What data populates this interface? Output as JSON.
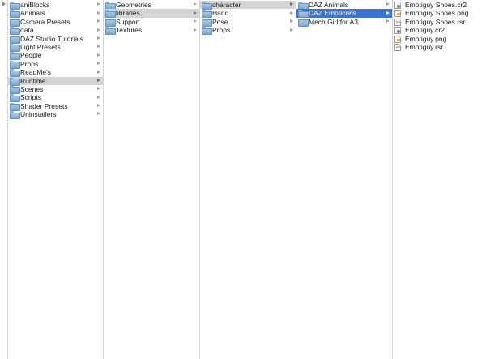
{
  "columns": [
    {
      "items": [
        {
          "label": "aniBlocks",
          "type": "folder"
        },
        {
          "label": "Animals",
          "type": "folder"
        },
        {
          "label": "Camera Presets",
          "type": "folder"
        },
        {
          "label": "data",
          "type": "folder"
        },
        {
          "label": "DAZ Studio Tutorials",
          "type": "folder"
        },
        {
          "label": "Light Presets",
          "type": "folder"
        },
        {
          "label": "People",
          "type": "folder"
        },
        {
          "label": "Props",
          "type": "folder"
        },
        {
          "label": "ReadMe's",
          "type": "folder"
        },
        {
          "label": "Runtime",
          "type": "folder",
          "selected": "inactive"
        },
        {
          "label": "Scenes",
          "type": "folder"
        },
        {
          "label": "Scripts",
          "type": "folder"
        },
        {
          "label": "Shader Presets",
          "type": "folder"
        },
        {
          "label": "Uninstallers",
          "type": "folder"
        }
      ]
    },
    {
      "items": [
        {
          "label": "Geometries",
          "type": "folder"
        },
        {
          "label": "libraries",
          "type": "folder",
          "selected": "inactive"
        },
        {
          "label": "Support",
          "type": "folder"
        },
        {
          "label": "Textures",
          "type": "folder"
        }
      ]
    },
    {
      "items": [
        {
          "label": "character",
          "type": "folder",
          "selected": "inactive"
        },
        {
          "label": "Hand",
          "type": "folder"
        },
        {
          "label": "Pose",
          "type": "folder"
        },
        {
          "label": "Props",
          "type": "folder"
        }
      ]
    },
    {
      "items": [
        {
          "label": "DAZ Animals",
          "type": "folder"
        },
        {
          "label": "DAZ Emoticons",
          "type": "folder",
          "selected": "active"
        },
        {
          "label": "Mech Girl for A3",
          "type": "folder"
        }
      ]
    },
    {
      "items": [
        {
          "label": "Emotiguy Shoes.cr2",
          "type": "cr2"
        },
        {
          "label": "Emotiguy Shoes.png",
          "type": "img"
        },
        {
          "label": "Emotiguy Shoes.rsr",
          "type": "doc"
        },
        {
          "label": "Emotiguy.cr2",
          "type": "cr2"
        },
        {
          "label": "Emotiguy.png",
          "type": "img"
        },
        {
          "label": "Emotiguy.rsr",
          "type": "doc"
        }
      ]
    }
  ],
  "colors": {
    "selection_active": "#3875d7",
    "selection_inactive": "#d4d4d4",
    "divider": "#d6d6d6"
  }
}
